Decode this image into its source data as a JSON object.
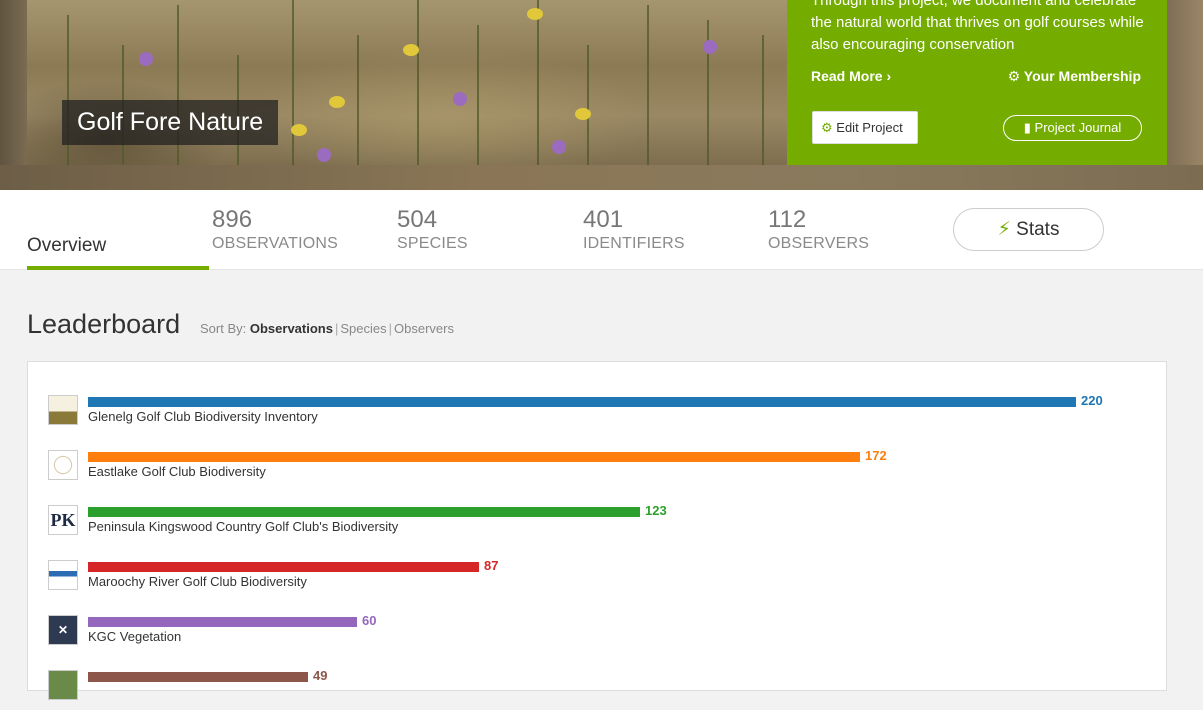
{
  "banner": {
    "title": "Golf Fore Nature"
  },
  "panel": {
    "description": "Through this project, we document and celebrate the natural world that thrives on golf courses while also encouraging conservation",
    "read_more": "Read More",
    "membership": "Your Membership",
    "edit_project": "Edit Project",
    "project_journal": "Project Journal",
    "accent_color": "#74ac00"
  },
  "stats": {
    "overview_tab": "Overview",
    "items": [
      {
        "value": "896",
        "label": "OBSERVATIONS"
      },
      {
        "value": "504",
        "label": "SPECIES"
      },
      {
        "value": "401",
        "label": "IDENTIFIERS"
      },
      {
        "value": "112",
        "label": "OBSERVERS"
      }
    ],
    "stats_button": "Stats"
  },
  "leaderboard": {
    "title": "Leaderboard",
    "sort_by_label": "Sort By:",
    "sort_options": [
      "Observations",
      "Species",
      "Observers"
    ],
    "active_sort": "Observations",
    "rows": [
      {
        "name": "Glenelg Golf Club Biodiversity Inventory",
        "value": 220,
        "color": "#1f77b4",
        "logo": "glenelg-logo-icon"
      },
      {
        "name": "Eastlake Golf Club Biodiversity",
        "value": 172,
        "color": "#ff7f0e",
        "logo": "eastlake-logo-icon"
      },
      {
        "name": "Peninsula Kingswood Country Golf Club's Biodiversity",
        "value": 123,
        "color": "#2ca02c",
        "logo": "pk-logo-icon"
      },
      {
        "name": "Maroochy River Golf Club Biodiversity",
        "value": 87,
        "color": "#d62728",
        "logo": "maroochy-logo-icon"
      },
      {
        "name": "KGC Vegetation",
        "value": 60,
        "color": "#9467bd",
        "logo": "kgc-logo-icon"
      },
      {
        "name": "",
        "value": 49,
        "color": "#8c564b",
        "logo": "sixth-logo-icon"
      }
    ]
  }
}
